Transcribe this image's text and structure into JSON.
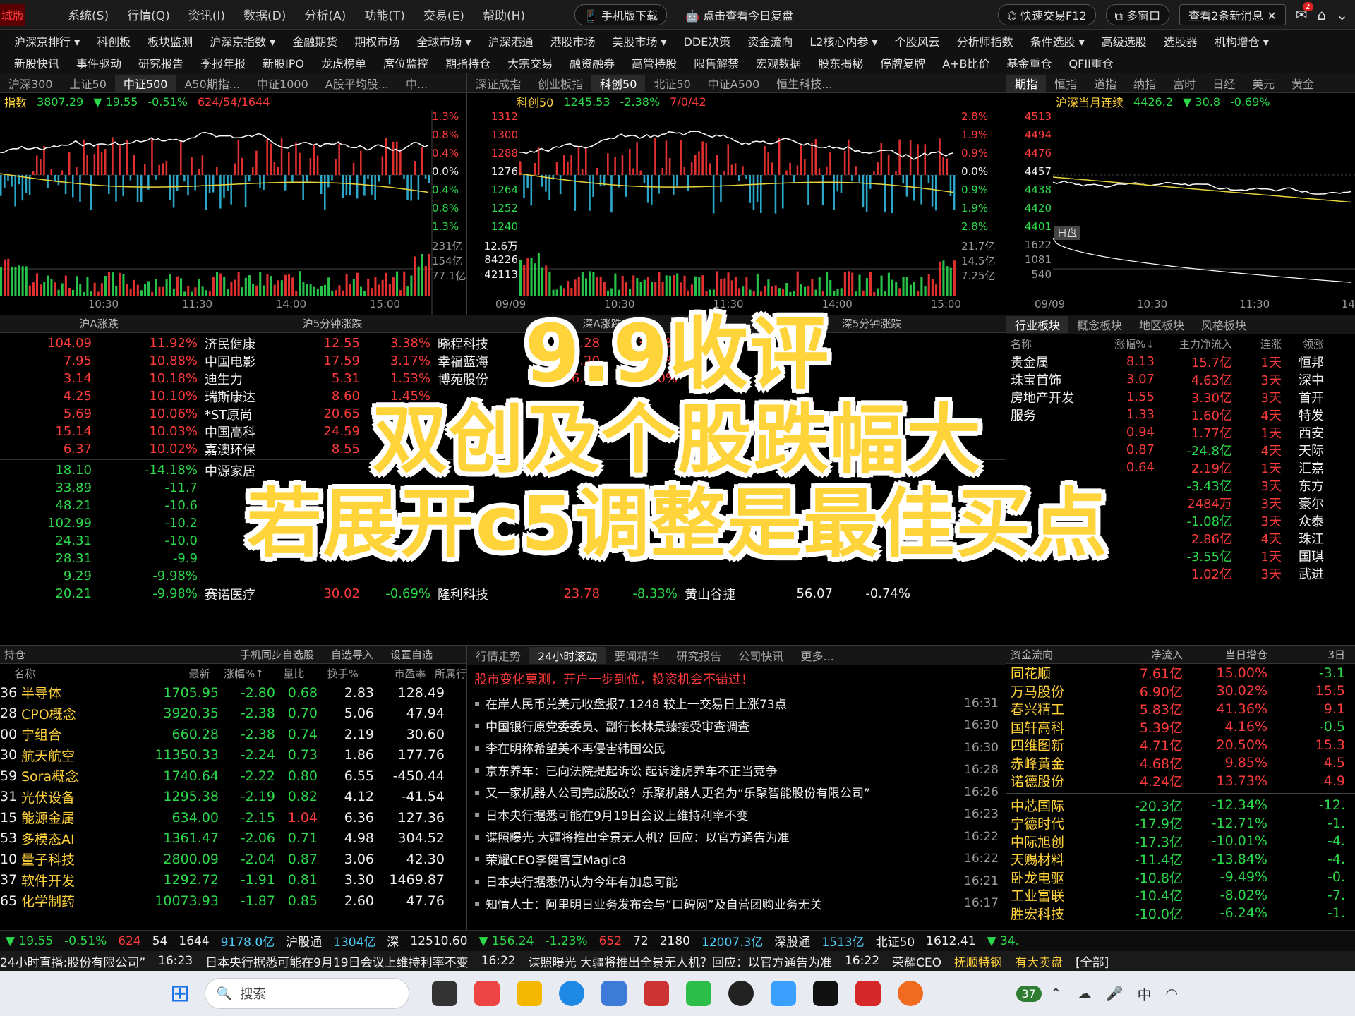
{
  "menu": {
    "left": "城版",
    "items": [
      "系统(S)",
      "行情(Q)",
      "资讯(I)",
      "数据(D)",
      "分析(A)",
      "功能(T)",
      "交易(E)",
      "帮助(H)"
    ],
    "pills": [
      "手机版下载",
      "点击查看今日复盘"
    ],
    "right": [
      "快速交易F12",
      "多窗口",
      "查看2条新消息"
    ],
    "badge": "2"
  },
  "nav1": [
    "沪深京排行",
    "科创板",
    "板块监测",
    "沪深京指数",
    "金融期货",
    "期权市场",
    "全球市场",
    "沪深港通",
    "港股市场",
    "美股市场",
    "DDE决策",
    "资金流向",
    "L2核心内参",
    "个股风云",
    "分析师指数",
    "条件选股",
    "高级选股",
    "选股器",
    "机构增仓"
  ],
  "nav2": [
    "新股快讯",
    "事件驱动",
    "研究报告",
    "季报年报",
    "新股IPO",
    "龙虎榜单",
    "席位监控",
    "期指持仓",
    "大宗交易",
    "融资融券",
    "高管持股",
    "限售解禁",
    "宏观数据",
    "股东揭秘",
    "停牌复牌",
    "A+B比价",
    "基金重仓",
    "QFII重仓"
  ],
  "tabs1": [
    "沪深300",
    "上证50",
    "中证500",
    "A50期指...",
    "中证1000",
    "A股平均股...",
    "中..."
  ],
  "tabs2": [
    "深证成指",
    "创业板指",
    "科创50",
    "北证50",
    "中证A500",
    "恒生科技..."
  ],
  "tabs3": [
    "期指",
    "恒指",
    "道指",
    "纳指",
    "富时",
    "日经",
    "美元",
    "黄金"
  ],
  "chart1": {
    "name": "指数",
    "value": "3807.29",
    "chg": "▼ 19.55",
    "pct": "-0.51%",
    "adv": "624/54/1644",
    "raxis": [
      "1.3%",
      "0.8%",
      "0.4%",
      "0.0%",
      "0.4%",
      "0.8%",
      "1.3%"
    ],
    "vol": [
      "231亿",
      "154亿",
      "77.1亿"
    ],
    "times": [
      "10:30",
      "11:30",
      "14:00",
      "15:00"
    ]
  },
  "chart2": {
    "name": "科创50",
    "value": "1245.53",
    "pct": "-2.38%",
    "adv": "7/0/42",
    "laxis": [
      "1312",
      "1300",
      "1288",
      "1276",
      "1264",
      "1252",
      "1240"
    ],
    "raxis": [
      "2.8%",
      "1.9%",
      "0.9%",
      "0.0%",
      "0.9%",
      "1.9%",
      "2.8%"
    ],
    "vol": [
      "12.6万",
      "84226",
      "42113"
    ],
    "rvol": [
      "21.7亿",
      "14.5亿",
      "7.25亿"
    ],
    "times": [
      "09/09",
      "10:30",
      "11:30",
      "14:00",
      "15:00"
    ]
  },
  "chart3": {
    "name": "沪深当月连续",
    "value": "4426.2",
    "chg": "▼ 30.8",
    "pct": "-0.69%",
    "laxis": [
      "4513",
      "4494",
      "4476",
      "4457",
      "4438",
      "4420",
      "4401"
    ],
    "vol": [
      "1622",
      "1081",
      "540"
    ],
    "tag": "日盘",
    "times": [
      "09/09",
      "10:30",
      "11:30",
      "14"
    ]
  },
  "sec1": {
    "h1": "沪A涨跌",
    "h2": "沪5分钟涨跌",
    "h3": "深A涨跌",
    "h4": "深5分钟涨跌"
  },
  "t1": [
    [
      "104.09",
      "11.92%",
      "济民健康",
      "12.55",
      "3.38%",
      "晓程科技",
      "7.28",
      "3.84%"
    ],
    [
      "7.95",
      "10.88%",
      "中国电影",
      "17.59",
      "3.17%",
      "幸福蓝海",
      "5.20",
      "3.61%"
    ],
    [
      "3.14",
      "10.18%",
      "迪生力",
      "5.31",
      "1.53%",
      "博苑股份",
      "6.74",
      "2.10%"
    ],
    [
      "4.25",
      "10.10%",
      "瑞斯康达",
      "8.60",
      "1.45%",
      "",
      "",
      ""
    ],
    [
      "5.69",
      "10.06%",
      "*ST原尚",
      "20.65",
      "",
      "",
      "",
      ""
    ],
    [
      "15.14",
      "10.03%",
      "中国高科",
      "24.59",
      "",
      "",
      "",
      ""
    ],
    [
      "6.37",
      "10.02%",
      "嘉澳环保",
      "8.55",
      "",
      "",
      "",
      ""
    ]
  ],
  "t1d": [
    [
      "18.10",
      "-14.18%",
      "中源家居"
    ],
    [
      "33.89",
      "-11.7",
      ""
    ],
    [
      "48.21",
      "-10.6",
      ""
    ],
    [
      "102.99",
      "-10.2",
      ""
    ],
    [
      "24.31",
      "-10.0",
      ""
    ],
    [
      "28.31",
      "-9.9",
      ""
    ],
    [
      "9.29",
      "-9.98%",
      ""
    ],
    [
      "20.21",
      "-9.98%",
      "赛诺医疗",
      "30.02",
      "-0.69%",
      "隆利科技",
      "23.78",
      "-8.33%",
      "黄山谷捷",
      "56.07",
      "-0.74%"
    ]
  ],
  "sectors": {
    "tabs": [
      "行业板块",
      "概念板块",
      "地区板块",
      "风格板块"
    ],
    "head": [
      "名称",
      "涨幅%↓",
      "主力净流入",
      "连涨",
      "领涨"
    ],
    "rows": [
      [
        "贵金属",
        "8.13",
        "15.7亿",
        "1天",
        "恒邦"
      ],
      [
        "珠宝首饰",
        "3.07",
        "4.63亿",
        "3天",
        "深中"
      ],
      [
        "房地产开发",
        "1.55",
        "3.30亿",
        "3天",
        "首开"
      ],
      [
        "服务",
        "1.33",
        "1.60亿",
        "4天",
        "特发"
      ],
      [
        "",
        "0.94",
        "1.77亿",
        "1天",
        "西安"
      ],
      [
        "",
        "0.87",
        "-24.8亿",
        "4天",
        "天际"
      ],
      [
        "",
        "0.64",
        "2.19亿",
        "1天",
        "汇嘉"
      ],
      [
        "",
        "",
        "-3.43亿",
        "3天",
        "东方"
      ],
      [
        "",
        "",
        "2484万",
        "3天",
        "豪尔"
      ],
      [
        "",
        "",
        "-1.08亿",
        "3天",
        "众泰"
      ],
      [
        "",
        "",
        "2.86亿",
        "4天",
        "珠江"
      ],
      [
        "",
        "",
        "-3.55亿",
        "1天",
        "国琪"
      ],
      [
        "",
        "",
        "1.02亿",
        "3天",
        "武进"
      ]
    ]
  },
  "watch": {
    "h": [
      "持仓",
      "手机同步自选股",
      "自选导入",
      "设置自选"
    ],
    "cols": [
      "名称",
      "最新",
      "涨幅%↑",
      "量比",
      "换手%",
      "市盈率",
      "所属行"
    ],
    "rows": [
      [
        "36",
        "半导体",
        "1705.95",
        "-2.80",
        "0.68",
        "2.83",
        "128.49"
      ],
      [
        "28",
        "CPO概念",
        "3920.35",
        "-2.38",
        "0.70",
        "5.06",
        "47.94"
      ],
      [
        "00",
        "宁组合",
        "660.28",
        "-2.38",
        "0.74",
        "2.19",
        "30.60"
      ],
      [
        "30",
        "航天航空",
        "11350.33",
        "-2.24",
        "0.73",
        "1.86",
        "177.76"
      ],
      [
        "59",
        "Sora概念",
        "1740.64",
        "-2.22",
        "0.80",
        "6.55",
        "-450.44"
      ],
      [
        "31",
        "光伏设备",
        "1295.38",
        "-2.19",
        "0.82",
        "4.12",
        "-41.54"
      ],
      [
        "15",
        "能源金属",
        "634.00",
        "-2.15",
        "1.04",
        "6.36",
        "127.36"
      ],
      [
        "53",
        "多模态AI",
        "1361.47",
        "-2.06",
        "0.71",
        "4.98",
        "304.52"
      ],
      [
        "10",
        "量子科技",
        "2800.09",
        "-2.04",
        "0.87",
        "3.06",
        "42.30"
      ],
      [
        "37",
        "软件开发",
        "1292.72",
        "-1.91",
        "0.81",
        "3.30",
        "1469.87"
      ],
      [
        "65",
        "化学制药",
        "10073.93",
        "-1.87",
        "0.85",
        "2.60",
        "47.76"
      ]
    ]
  },
  "news": {
    "tabs": [
      "行情走势",
      "24小时滚动",
      "要闻精华",
      "研究报告",
      "公司快讯",
      "更多..."
    ],
    "headline": "股市变化莫测，开户一步到位，投资机会不错过！",
    "items": [
      [
        "在岸人民币兑美元收盘报7.1248 较上一交易日上涨73点",
        "16:31"
      ],
      [
        "中国银行原党委委员、副行长林景臻接受审查调查",
        "16:30"
      ],
      [
        "李在明称希望美不再侵害韩国公民",
        "16:30"
      ],
      [
        "京东养车：已向法院提起诉讼 起诉途虎养车不正当竞争",
        "16:28"
      ],
      [
        "又一家机器人公司完成股改？乐聚机器人更名为“乐聚智能股份有限公司”",
        "16:26"
      ],
      [
        "日本央行据悉可能在9月19日会议上维持利率不变",
        "16:23"
      ],
      [
        "谍照曝光 大疆将推出全景无人机？回应：以官方通告为准",
        "16:22"
      ],
      [
        "荣耀CEO李健官宣Magic8",
        "16:22"
      ],
      [
        "日本央行据悉仍认为今年有加息可能",
        "16:21"
      ],
      [
        "知情人士：阿里明日业务发布会与“口碑网”及自营团购业务无关",
        "16:17"
      ]
    ]
  },
  "flow": {
    "h": [
      "资金流向",
      "净流入",
      "当日增仓",
      "3日"
    ],
    "in": [
      [
        "同花顺",
        "7.61亿",
        "15.00%",
        "-3.1"
      ],
      [
        "万马股份",
        "6.90亿",
        "30.02%",
        "15.5"
      ],
      [
        "春兴精工",
        "5.83亿",
        "41.36%",
        "9.1"
      ],
      [
        "国轩高科",
        "5.39亿",
        "4.16%",
        "-0.5"
      ],
      [
        "四维图新",
        "4.71亿",
        "20.50%",
        "15.3"
      ],
      [
        "赤峰黄金",
        "4.68亿",
        "9.85%",
        "4.5"
      ],
      [
        "诺德股份",
        "4.24亿",
        "13.73%",
        "4.9"
      ]
    ],
    "out": [
      [
        "中芯国际",
        "-20.3亿",
        "-12.34%",
        "-12."
      ],
      [
        "宁德时代",
        "-17.9亿",
        "-12.71%",
        "-1."
      ],
      [
        "中际旭创",
        "-17.3亿",
        "-10.01%",
        "-4."
      ],
      [
        "天赐材料",
        "-11.4亿",
        "-13.84%",
        "-4."
      ],
      [
        "卧龙电驱",
        "-10.8亿",
        "-9.49%",
        "-0."
      ],
      [
        "工业富联",
        "-10.4亿",
        "-8.02%",
        "-7."
      ],
      [
        "胜宏科技",
        "-10.0亿",
        "-6.24%",
        "-1."
      ]
    ]
  },
  "status": [
    "▼ 19.55",
    "-0.51%",
    "624",
    "54",
    "1644",
    "9178.0亿",
    "沪股通",
    "1304亿",
    "深",
    "12510.60",
    "▼ 156.24",
    "-1.23%",
    "652",
    "72",
    "2180",
    "12007.3亿",
    "深股通",
    "1513亿",
    "北证50",
    "1612.41",
    "▼ 34."
  ],
  "ticker": [
    "24小时直播:股份有限公司”",
    "16:23",
    "日本央行据悉可能在9月19日会议上维持利率不变",
    "16:22",
    "谍照曝光 大疆将推出全景无人机？回应：以官方通告为准",
    "16:22",
    "荣耀CEO",
    "抚顺特钢",
    "有大卖盘",
    "[全部]"
  ],
  "overlay": [
    "9.9收评",
    "双创及个股跌幅大",
    "若展开c5调整是最佳买点"
  ],
  "taskbar": {
    "search": "搜索",
    "badge": "37",
    "lang": "中"
  }
}
